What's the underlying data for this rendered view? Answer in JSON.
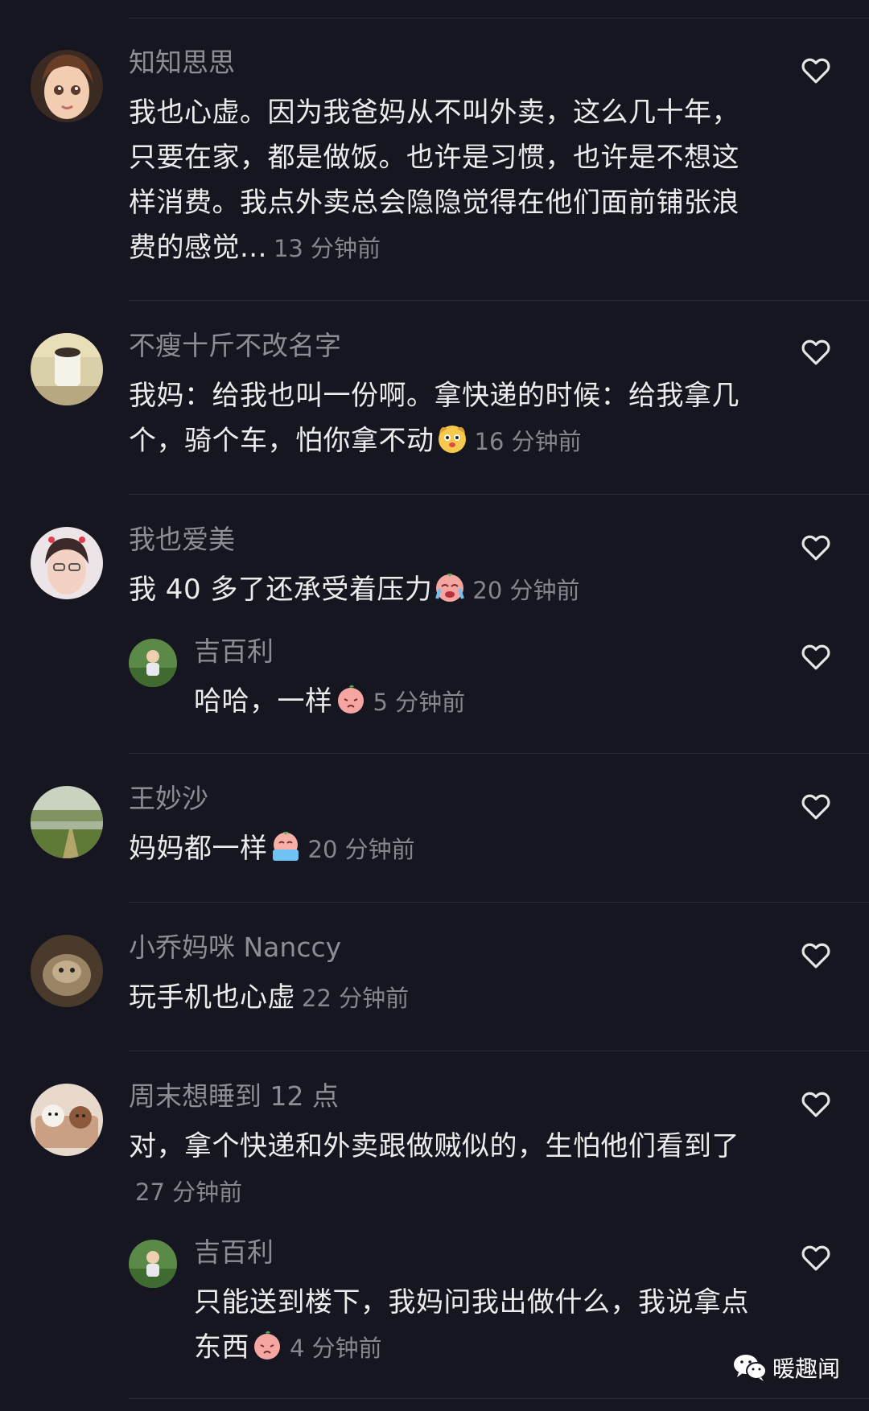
{
  "comments": [
    {
      "name": "知知思思",
      "text": "我也心虚。因为我爸妈从不叫外卖，这么几十年，只要在家，都是做饭。也许是习惯，也许是不想这样消费。我点外卖总会隐隐觉得在他们面前铺张浪费的感觉...",
      "time": "13 分钟前",
      "avatar_color": "#c8a07c"
    },
    {
      "name": "不瘦十斤不改名字",
      "text": "我妈：给我也叫一份啊。拿快递的时候：给我拿几个，骑个车，怕你拿不动",
      "emoji": "dog-face-emoji",
      "time": "16 分钟前",
      "avatar_color": "#d9d2b4"
    },
    {
      "name": "我也爱美",
      "text": "我 40 多了还承受着压力",
      "emoji": "crying-face-emoji",
      "time": "20 分钟前",
      "avatar_color": "#d8c4c8"
    },
    {
      "name": "吉百利",
      "text": "哈哈，一样",
      "emoji": "peach-face-emoji",
      "time": "5 分钟前",
      "avatar_color": "#6f9a5c",
      "is_reply": true
    },
    {
      "name": "王妙沙",
      "text": "妈妈都一样",
      "emoji": "tears-face-emoji",
      "time": "20 分钟前",
      "avatar_color": "#6b8a4a"
    },
    {
      "name": "小乔妈咪 Nanccy",
      "text": "玩手机也心虚",
      "time": "22 分钟前",
      "avatar_color": "#7a6a55"
    },
    {
      "name": "周末想睡到 12 点",
      "text": "对，拿个快递和外卖跟做贼似的，生怕他们看到了",
      "time": "27 分钟前",
      "avatar_color": "#c9a58c"
    },
    {
      "name": "吉百利",
      "text": "只能送到楼下，我妈问我出做什么，我说拿点东西",
      "emoji": "peach-face-emoji",
      "time": "4 分钟前",
      "avatar_color": "#6f9a5c",
      "is_reply": true
    }
  ],
  "watermark": {
    "label": "暖趣闻",
    "icon": "wechat-icon"
  },
  "colors": {
    "background": "#161621",
    "name": "#8d8d95",
    "text": "#ececec",
    "time": "#86868e",
    "divider": "#2a2a34"
  }
}
